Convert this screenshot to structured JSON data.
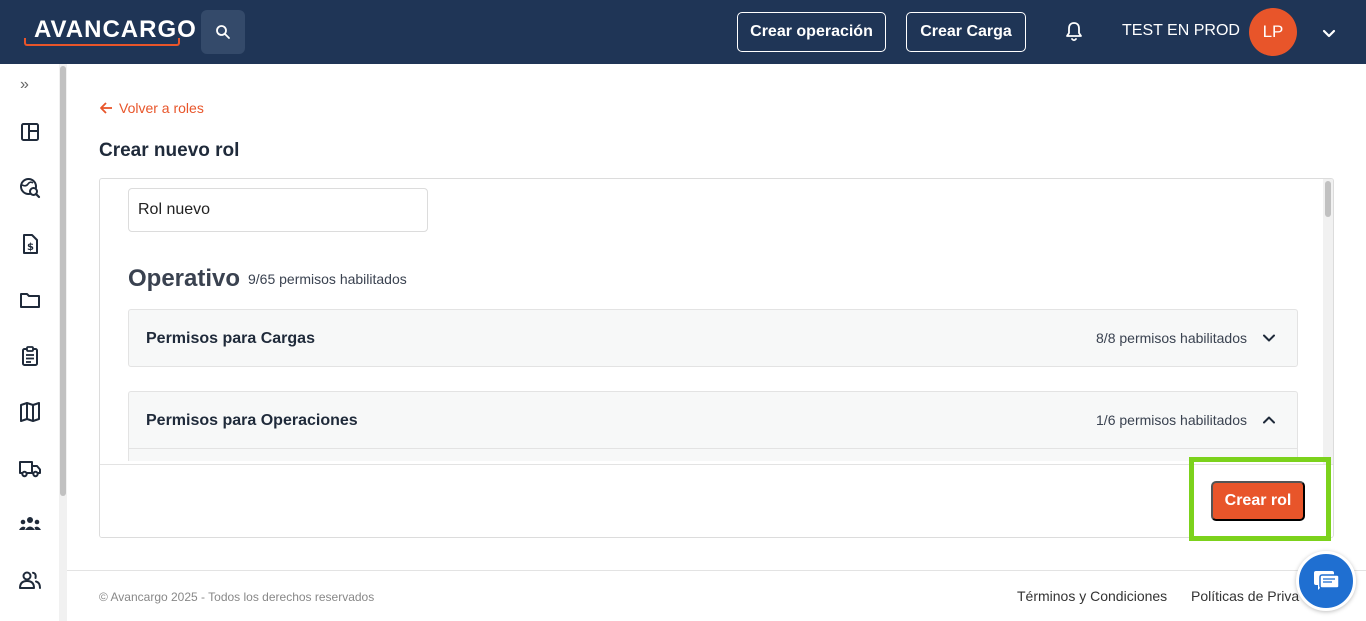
{
  "header": {
    "logo_text": "AVANCARGO",
    "search_icon": "search-icon",
    "create_operation_label": "Crear operación",
    "create_load_label": "Crear Carga",
    "notifications_icon": "bell-icon",
    "user_name": "TEST EN PROD",
    "user_initials": "LP",
    "user_menu_icon": "chevron-down-icon",
    "brand_color": "#1f3556",
    "accent_color": "#e8552a"
  },
  "sidebar": {
    "expand_label": "»",
    "items": [
      {
        "icon": "dashboard-icon"
      },
      {
        "icon": "globe-search-icon"
      },
      {
        "icon": "invoice-icon"
      },
      {
        "icon": "folder-icon"
      },
      {
        "icon": "clipboard-icon"
      },
      {
        "icon": "map-icon"
      },
      {
        "icon": "truck-icon"
      },
      {
        "icon": "group-icon"
      },
      {
        "icon": "users-icon"
      }
    ]
  },
  "main": {
    "back_label": "Volver a roles",
    "title": "Crear nuevo rol",
    "role_name_value": "Rol nuevo",
    "section": {
      "title": "Operativo",
      "count": "9/65 permisos habilitados"
    },
    "permission_groups": [
      {
        "label": "Permisos para Cargas",
        "count": "8/8 permisos habilitados",
        "expanded": false
      },
      {
        "label": "Permisos para Operaciones",
        "count": "1/6 permisos habilitados",
        "expanded": true
      }
    ],
    "create_button_label": "Crear rol",
    "highlight_color": "#7cd21c"
  },
  "footer": {
    "copyright": "© Avancargo 2025 - Todos los derechos reservados",
    "terms_label": "Términos y Condiciones",
    "privacy_label": "Políticas de Priva",
    "chat_icon": "chat-icon"
  }
}
